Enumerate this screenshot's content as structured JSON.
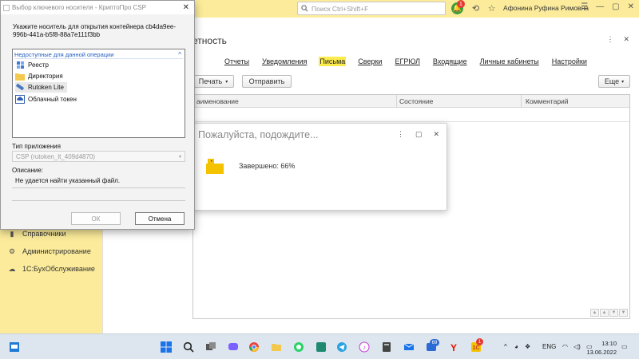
{
  "app": {
    "search_placeholder": "Поиск Ctrl+Shift+F",
    "notification_count": "1",
    "user_name": "Афонина Руфина Римовна",
    "form_title": "етность",
    "tabs": [
      {
        "label": "Отчеты",
        "active": false
      },
      {
        "label": "Уведомления",
        "active": false
      },
      {
        "label": "Письма",
        "active": true
      },
      {
        "label": "Сверки",
        "active": false
      },
      {
        "label": "ЕГРЮЛ",
        "active": false
      },
      {
        "label": "Входящие",
        "active": false
      },
      {
        "label": "Личные кабинеты",
        "active": false
      },
      {
        "label": "Настройки",
        "active": false
      }
    ],
    "print_label": "Печать",
    "send_label": "Отправить",
    "more_label": "Еще",
    "columns": {
      "name": "аименование",
      "status": "Состояние",
      "comment": "Комментарий"
    },
    "sidebar": [
      {
        "label": "Справочники",
        "icon": "book-icon"
      },
      {
        "label": "Администрирование",
        "icon": "gear-icon"
      },
      {
        "label": "1С:БухОбслуживание",
        "icon": "cloud-icon"
      }
    ],
    "accent_color": "#fbeb9a"
  },
  "wait_dialog": {
    "title": "Пожалуйста, подождите...",
    "status": "Завершено: 66%",
    "progress_percent": 66
  },
  "cryptopro": {
    "title": "Выбор ключевого носителя - КриптоПро CSP",
    "prompt": "Укажите носитель для открытия контейнера cb4da9ee-996b-441a-b5f8-88a7e111f3bb",
    "group_label": "Недоступные для данной операции",
    "items": [
      {
        "label": "Реестр",
        "icon": "registry-icon"
      },
      {
        "label": "Директория",
        "icon": "folder-icon"
      },
      {
        "label": "Rutoken Lite",
        "icon": "usb-token-icon",
        "selected": true
      },
      {
        "label": "Облачный токен",
        "icon": "cloud-token-icon"
      }
    ],
    "app_type_label": "Тип приложения",
    "app_type_value": "CSP (rutoken_lt_409d4870)",
    "description_label": "Описание:",
    "description_value": "Не удается найти указанный файл.",
    "ok_label": "ОК",
    "cancel_label": "Отмена"
  },
  "taskbar": {
    "weather_badge": "69",
    "lang": "ENG",
    "time": "13:10",
    "date": "13.06.2022",
    "app_badge": "1"
  }
}
